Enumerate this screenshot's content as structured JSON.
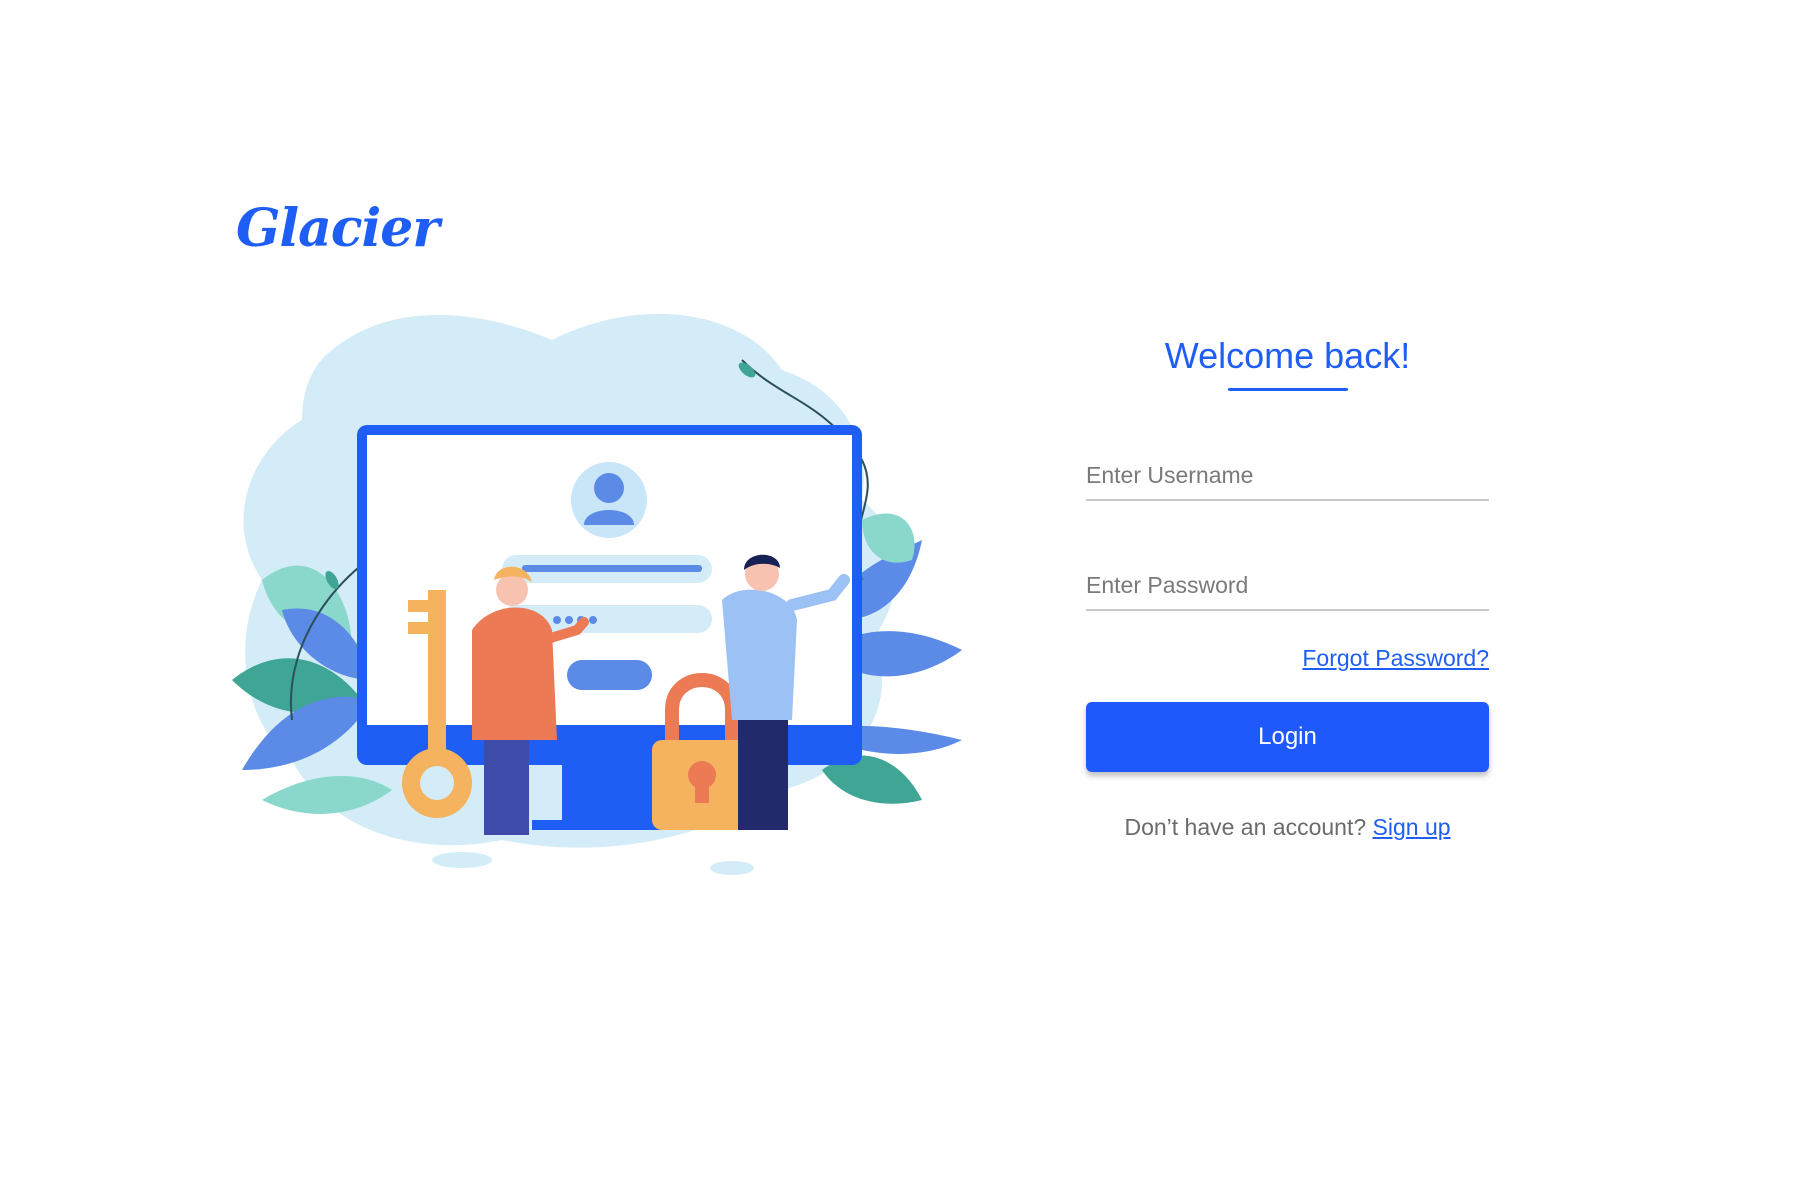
{
  "brand": {
    "logo_text": "Glacier",
    "accent_color": "#1f5ef5"
  },
  "illustration": {
    "name": "login-illustration"
  },
  "form": {
    "title": "Welcome back!",
    "username_placeholder": "Enter Username",
    "password_placeholder": "Enter Password",
    "forgot_label": "Forgot Password?",
    "login_label": "Login",
    "signup_prompt": "Don’t have an account?",
    "signup_label": "Sign up"
  }
}
